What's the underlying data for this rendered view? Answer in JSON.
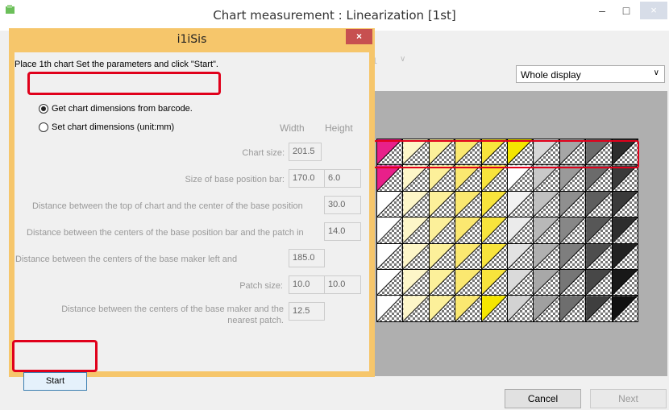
{
  "main_window": {
    "title": "Chart measurement : Linearization [1st]",
    "minimize": "–",
    "maximize": "□",
    "close": "×",
    "behind_combo_value": "1",
    "display_select": "Whole display",
    "cancel_label": "Cancel",
    "next_label": "Next"
  },
  "dialog": {
    "title": "i1iSis",
    "close": "×",
    "instruction": "Place 1th chart Set the parameters and click \"Start\".",
    "radio_barcode": "Get chart dimensions from barcode.",
    "radio_manual": "Set chart dimensions (unit:mm)",
    "col_width": "Width",
    "col_height": "Height",
    "chart_size_label": "Chart size:",
    "chart_size_width": "201.5",
    "base_bar_label": "Size of base position bar:",
    "base_bar_width": "170.0",
    "base_bar_height": "6.0",
    "top_distance_label": "Distance between the top of chart and the center of the base position",
    "top_distance_value": "30.0",
    "bar_patch_label": "Distance between the centers of the base position bar and the patch in",
    "bar_patch_value": "14.0",
    "maker_label": "Distance between the centers of the base maker left and",
    "maker_value": "185.0",
    "patch_size_label": "Patch size:",
    "patch_width": "10.0",
    "patch_height": "10.0",
    "nearest_label_1": "Distance between the centers of the base maker and the",
    "nearest_label_2": "nearest patch.",
    "nearest_value": "12.5",
    "start_label": "Start"
  },
  "colors": {
    "dialog_frame": "#f6c66b",
    "highlight": "#e0001b",
    "close_button": "#c75050"
  },
  "chart_patches": [
    [
      "#e8208a",
      "#fdf6c8",
      "#fcf09a",
      "#fbe870",
      "#f8e43c",
      "#f5e600",
      "#d7d7d7",
      "#a6a6a6",
      "#6b6b6b",
      "#2d2d2d"
    ],
    [
      "#e8208a",
      "#fdf6c8",
      "#fcf09a",
      "#fbe870",
      "#f8e43c",
      "#ffffff",
      "#c8c8c8",
      "#9a9a9a",
      "#6b6b6b",
      "#3a3a3a"
    ],
    [
      "#ffffff",
      "#fdf6c8",
      "#fcf09a",
      "#fbe870",
      "#f8e43c",
      "#f2f2f2",
      "#c0c0c0",
      "#8f8f8f",
      "#5e5e5e",
      "#3a3a3a"
    ],
    [
      "#ffffff",
      "#fdf6c8",
      "#fcf09a",
      "#fbe870",
      "#f8e43c",
      "#ebebeb",
      "#b8b8b8",
      "#878787",
      "#575757",
      "#2d2d2d"
    ],
    [
      "#ffffff",
      "#fdf6c8",
      "#fcf09a",
      "#fbe870",
      "#f8e43c",
      "#e2e2e2",
      "#b0b0b0",
      "#7e7e7e",
      "#4e4e4e",
      "#222222"
    ],
    [
      "#ffffff",
      "#fdf6c8",
      "#fcf09a",
      "#fbe870",
      "#f8e43c",
      "#dadada",
      "#a8a8a8",
      "#767676",
      "#474747",
      "#181818"
    ],
    [
      "#ffffff",
      "#fdf6c8",
      "#fcf09a",
      "#fbe870",
      "#f5e600",
      "#d2d2d2",
      "#a0a0a0",
      "#6e6e6e",
      "#3f3f3f",
      "#111111"
    ]
  ]
}
